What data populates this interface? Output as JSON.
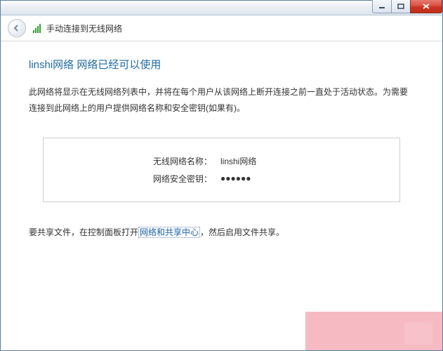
{
  "window": {
    "title": "手动连接到无线网络"
  },
  "content": {
    "heading": "linshi网络 网络已经可以使用",
    "description": "此网络将显示在无线网络列表中，并将在每个用户从该网络上断开连接之前一直处于活动状态。为需要连接到此网络上的用户提供网络名称和安全密钥(如果有)。",
    "fields": {
      "ssid_label": "无线网络名称：",
      "ssid_value": "linshi网络",
      "key_label": "网络安全密钥：",
      "key_value": "●●●●●●"
    },
    "share": {
      "prefix": "要共享文件，在控制面板打开",
      "link": "网络和共享中心",
      "suffix": "，然后启用文件共享。"
    }
  }
}
